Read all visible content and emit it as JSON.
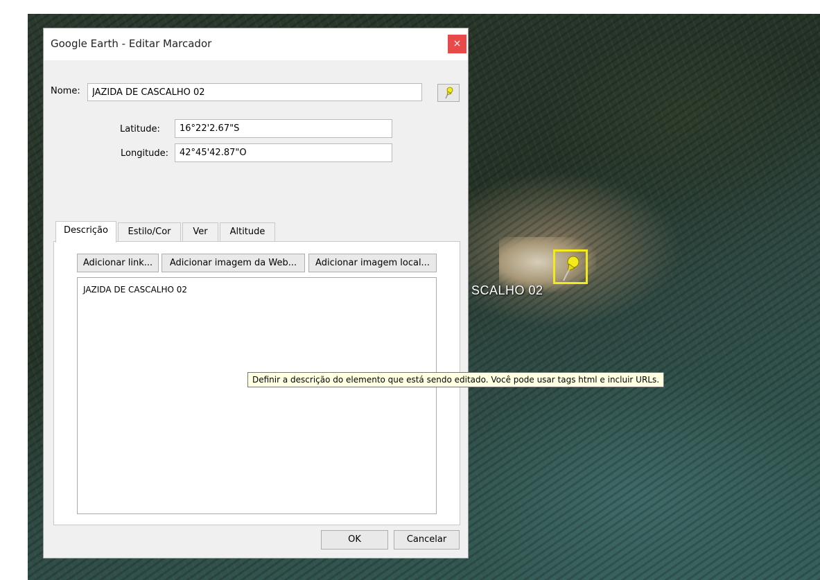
{
  "map": {
    "placemark_label": "SCALHO 02"
  },
  "dialog": {
    "title": "Google Earth - Editar Marcador",
    "close_glyph": "×",
    "name_label": "Nome:",
    "name_value": "JAZIDA DE CASCALHO 02",
    "latitude_label": "Latitude:",
    "latitude_value": "16°22'2.67\"S",
    "longitude_label": "Longitude:",
    "longitude_value": "42°45'42.87\"O",
    "tabs": [
      {
        "label": "Descrição",
        "active": true
      },
      {
        "label": "Estilo/Cor",
        "active": false
      },
      {
        "label": "Ver",
        "active": false
      },
      {
        "label": "Altitude",
        "active": false
      }
    ],
    "buttons": {
      "add_link": "Adicionar link...",
      "add_web_image": "Adicionar imagem da Web...",
      "add_local_image": "Adicionar imagem local..."
    },
    "description_text": "JAZIDA DE CASCALHO 02",
    "ok": "OK",
    "cancel": "Cancelar"
  },
  "tooltip": "Definir a descrição do elemento que está sendo editado. Você pode usar tags html e incluir URLs.",
  "icons": {
    "pin": "pushpin-icon",
    "close": "close-icon"
  },
  "colors": {
    "pin_yellow": "#f3ea1c",
    "close_red": "#e84a4a",
    "tooltip_bg": "#ffffe1"
  }
}
